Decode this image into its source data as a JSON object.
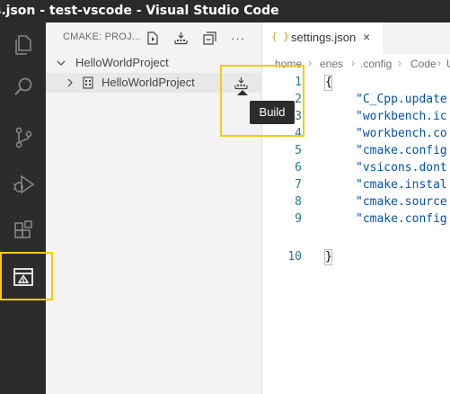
{
  "window": {
    "title": "s.json - test-vscode - Visual Studio Code"
  },
  "activity_bar": {
    "items": [
      "explorer",
      "search",
      "source-control",
      "run-and-debug",
      "extensions",
      "cmake"
    ],
    "active": "cmake"
  },
  "sidebar": {
    "title": "CMAKE: PROJ...",
    "actions": [
      "configure",
      "build-all",
      "collapse-all",
      "more-actions"
    ],
    "more_label": "···",
    "tree": {
      "root_label": "HelloWorldProject",
      "child_label": "HelloWorldProject"
    },
    "tooltip": "Build"
  },
  "editor": {
    "tab": {
      "label": "settings.json",
      "icon_text": "{ }",
      "close_glyph": "×"
    },
    "breadcrumb": [
      "home",
      "enes",
      ".config",
      "Code",
      "U"
    ],
    "breadcrumb_sep": "›",
    "lines": [
      {
        "num": "1",
        "text": "{"
      },
      {
        "num": "2",
        "text": "\"C_Cpp.update"
      },
      {
        "num": "3",
        "text": "\"workbench.ic"
      },
      {
        "num": "4",
        "text": "\"workbench.co"
      },
      {
        "num": "5",
        "text": "\"cmake.config"
      },
      {
        "num": "6",
        "text": "\"vsicons.dont"
      },
      {
        "num": "7",
        "text": "\"cmake.instal"
      },
      {
        "num": "8",
        "text": "\"cmake.source"
      },
      {
        "num": "9",
        "text": "\"cmake.config"
      },
      {
        "num": "10",
        "text": "}"
      }
    ]
  },
  "colors": {
    "highlight": "#f2cc0d",
    "line_numbers": "#237893",
    "string": "#0451a5",
    "activity_bar": "#2c2c2c"
  }
}
